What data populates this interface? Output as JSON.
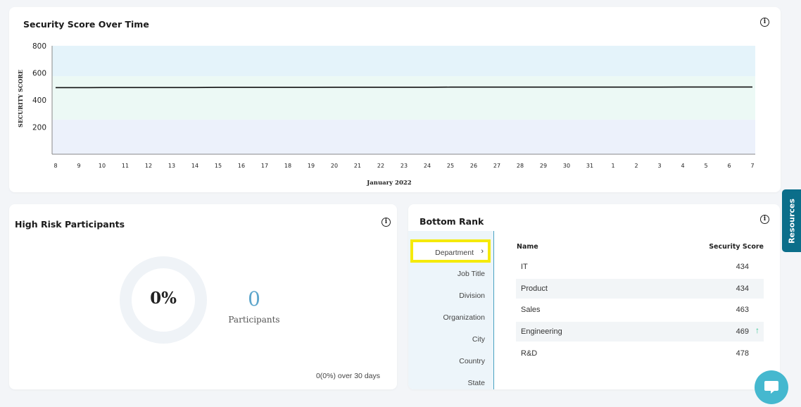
{
  "chart_card": {
    "title": "Security Score Over Time",
    "info_icon": "info-icon"
  },
  "chart_data": {
    "type": "line",
    "title": "Security Score Over Time",
    "ylabel": "SECURITY SCORE",
    "xlabel": "January 2022",
    "ylim": [
      0,
      800
    ],
    "y_ticks": [
      "200",
      "400",
      "600",
      "800"
    ],
    "categories": [
      "8",
      "9",
      "10",
      "11",
      "12",
      "13",
      "14",
      "15",
      "16",
      "17",
      "18",
      "19",
      "20",
      "21",
      "22",
      "23",
      "24",
      "25",
      "26",
      "27",
      "28",
      "29",
      "30",
      "31",
      "1",
      "2",
      "3",
      "4",
      "5",
      "6",
      "7"
    ],
    "series": [
      {
        "values": [
          491,
          491,
          492,
          492,
          492,
          492,
          492,
          493,
          493,
          493,
          493,
          493,
          494,
          494,
          494,
          494,
          494,
          495,
          495,
          495,
          495,
          495,
          495,
          495,
          495,
          495,
          495,
          496,
          496,
          496,
          496
        ]
      }
    ],
    "bands": [
      {
        "from": 0,
        "to": 255,
        "color": "#ecf1fb"
      },
      {
        "from": 255,
        "to": 575,
        "color": "#ecf9f5"
      },
      {
        "from": 575,
        "to": 800,
        "color": "#e4f3fa"
      }
    ],
    "line_color": "#111111",
    "grid": false
  },
  "risk_card": {
    "title": "High Risk Participants",
    "percent": "0%",
    "count": "0",
    "count_label": "Participants",
    "footer": "0(0%) over 30 days",
    "info_icon": "info-icon"
  },
  "rank_card": {
    "title": "Bottom Rank",
    "info_icon": "info-icon",
    "tabs": [
      {
        "label": "Department",
        "active": true
      },
      {
        "label": "Job Title"
      },
      {
        "label": "Division"
      },
      {
        "label": "Organization"
      },
      {
        "label": "City"
      },
      {
        "label": "Country"
      },
      {
        "label": "State"
      }
    ],
    "columns": {
      "name": "Name",
      "score": "Security Score"
    },
    "rows": [
      {
        "name": "IT",
        "score": "434"
      },
      {
        "name": "Product",
        "score": "434"
      },
      {
        "name": "Sales",
        "score": "463"
      },
      {
        "name": "Engineering",
        "score": "469",
        "trend": "arrow-up-icon"
      },
      {
        "name": "R&D",
        "score": "478"
      }
    ],
    "trend_glyph": "↑",
    "trend_color": "#37c493"
  },
  "resources_tab": {
    "label": "Resources",
    "color": "#0b6e8a"
  },
  "chat": {
    "icon": "chat-bubble-icon",
    "color": "#45b8cf"
  },
  "colors": {
    "highlight": "#f5ea0b",
    "accent": "#4aa3c1",
    "count_color": "#5ea6cc"
  }
}
